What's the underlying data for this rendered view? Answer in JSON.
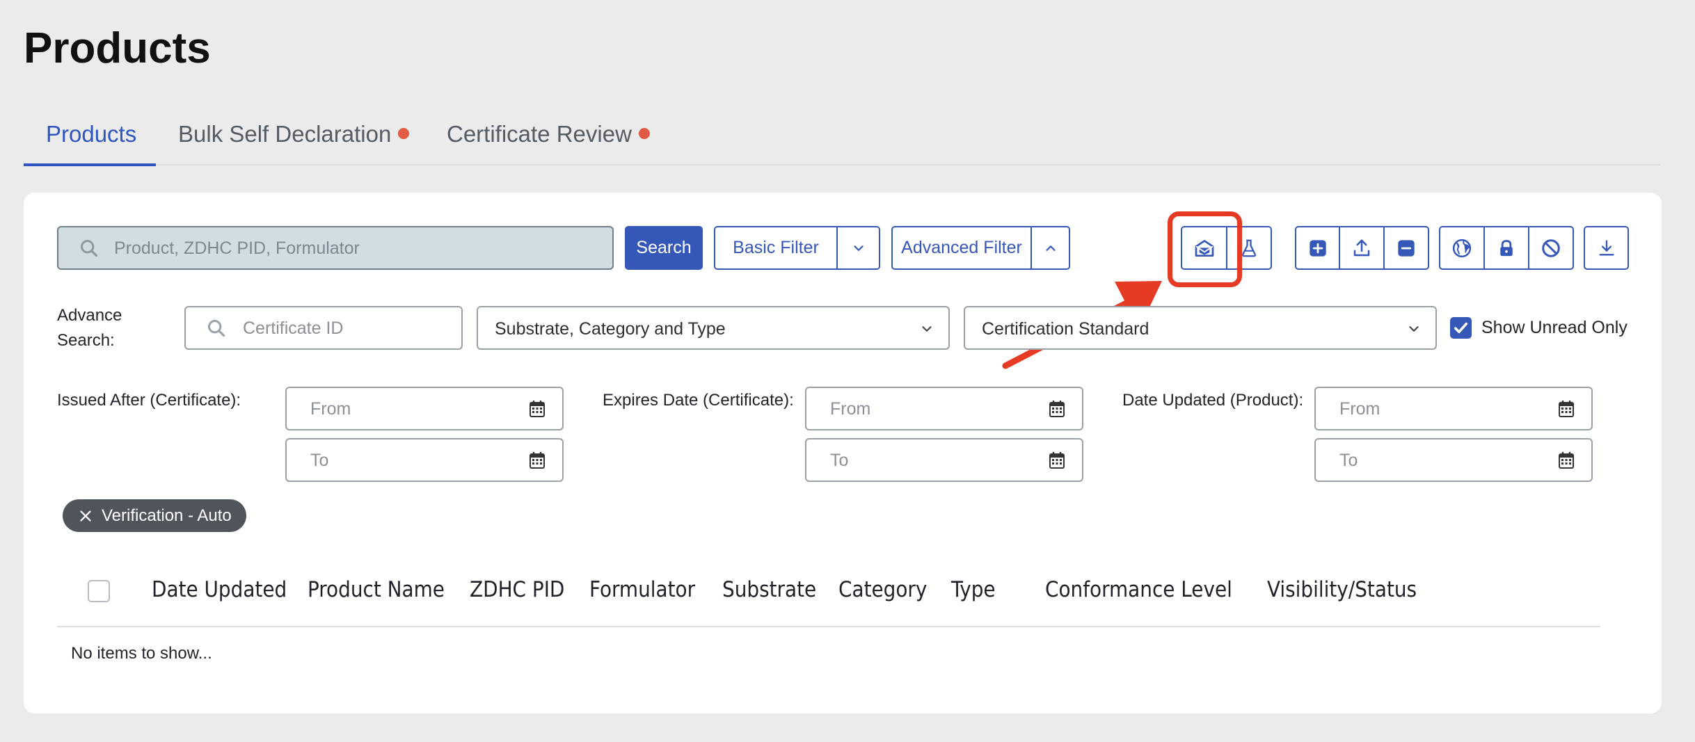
{
  "page": {
    "title": "Products"
  },
  "tabs": [
    {
      "label": "Products",
      "active": true,
      "dot": false
    },
    {
      "label": "Bulk Self Declaration",
      "active": false,
      "dot": true
    },
    {
      "label": "Certificate Review",
      "active": false,
      "dot": true
    }
  ],
  "toolbar": {
    "search_placeholder": "Product, ZDHC PID, Formulator",
    "search_button": "Search",
    "basic_filter": "Basic Filter",
    "advanced_filter": "Advanced Filter",
    "icons": [
      "mail-open-icon",
      "flask-icon",
      "plus-square-icon",
      "upload-icon",
      "minus-square-icon",
      "globe-icon",
      "lock-icon",
      "ban-icon",
      "download-icon"
    ]
  },
  "advanced": {
    "label": "Advance Search:",
    "certificate_placeholder": "Certificate ID",
    "substrate_select": "Substrate, Category and Type",
    "certification_select": "Certification Standard",
    "show_unread_label": "Show Unread Only",
    "show_unread_checked": true
  },
  "dates": [
    {
      "label": "Issued After (Certificate):",
      "from": "From",
      "to": "To"
    },
    {
      "label": "Expires Date (Certificate):",
      "from": "From",
      "to": "To"
    },
    {
      "label": "Date Updated (Product):",
      "from": "From",
      "to": "To"
    }
  ],
  "chips": [
    {
      "label": "Verification - Auto"
    }
  ],
  "table": {
    "columns": [
      "Date Updated",
      "Product Name",
      "ZDHC PID",
      "Formulator",
      "Substrate",
      "Category",
      "Type",
      "Conformance Level",
      "Visibility/Status"
    ],
    "empty_text": "No items to show..."
  },
  "colors": {
    "primary": "#3457b8",
    "annotation": "#e53a23",
    "dot": "#e25a44"
  }
}
